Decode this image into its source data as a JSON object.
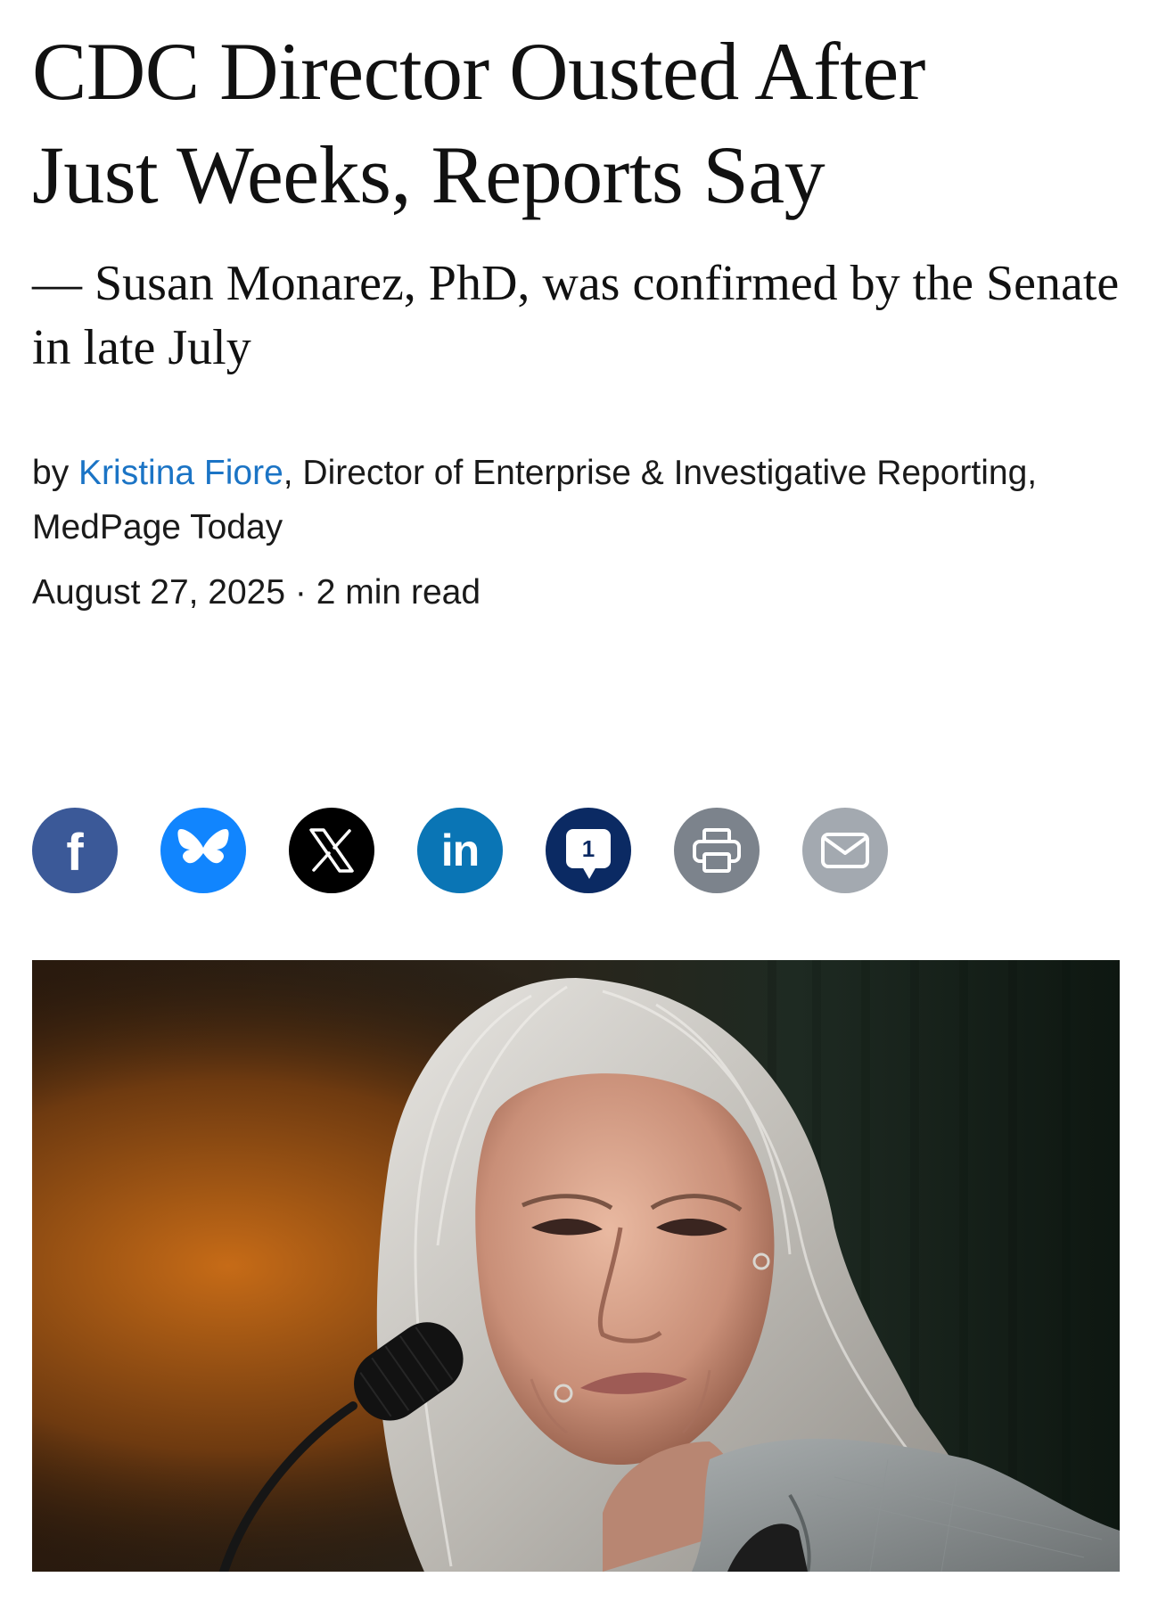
{
  "article": {
    "headline_lines": [
      "CDC Director Ousted After",
      "Just Weeks, Reports Say"
    ],
    "dek": "— Susan Monarez, PhD, was confirmed by the Senate in late July",
    "byline": {
      "prefix": "by ",
      "author": "Kristina Fiore",
      "title": ", Director of Enterprise & Investigative Reporting, MedPage Today"
    },
    "date": "August 27, 2025",
    "separator": " · ",
    "read_time": "2 min read"
  },
  "share": {
    "buttons": [
      {
        "name": "facebook",
        "icon": "facebook-icon",
        "glyph": "f",
        "color": "#3b5998"
      },
      {
        "name": "bluesky",
        "icon": "bluesky-butterfly-icon",
        "color": "#1185fe"
      },
      {
        "name": "x",
        "icon": "x-icon",
        "glyph": "𝕏",
        "color": "#000000"
      },
      {
        "name": "linkedin",
        "icon": "linkedin-icon",
        "glyph": "in",
        "color": "#0a75b5"
      },
      {
        "name": "comments",
        "icon": "comment-bubble-icon",
        "count": "1",
        "color": "#0b2a63"
      },
      {
        "name": "print",
        "icon": "printer-icon",
        "color": "#7c838c"
      },
      {
        "name": "email",
        "icon": "envelope-icon",
        "color": "#a3a9b0"
      }
    ]
  },
  "hero_image": {
    "subject": "photo-portrait"
  }
}
